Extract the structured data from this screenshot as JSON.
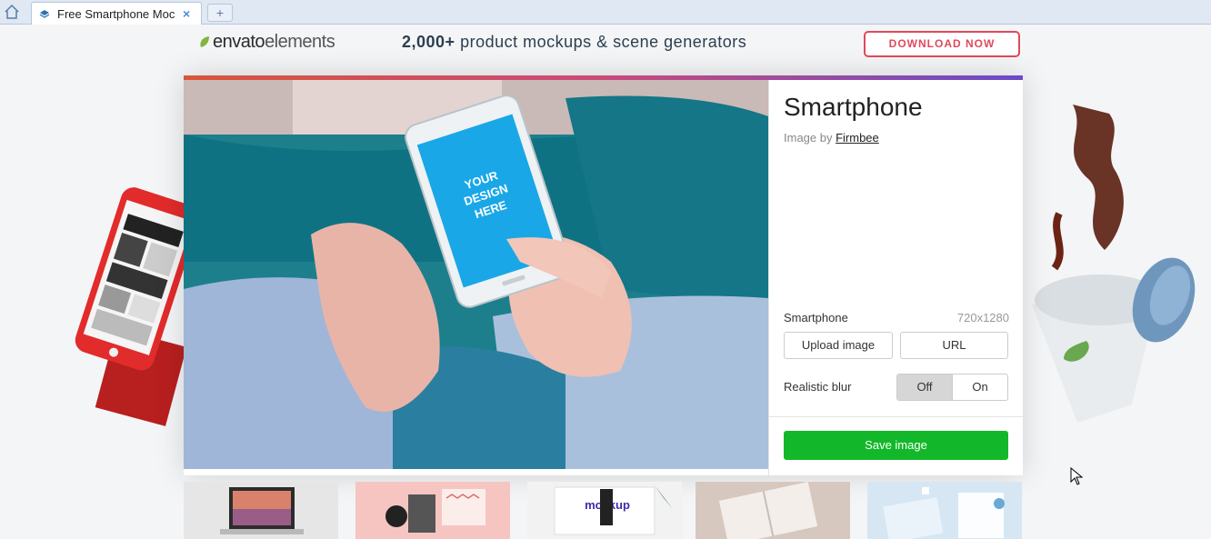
{
  "browser": {
    "tab_title": "Free Smartphone Moc",
    "tab_close": "×",
    "new_tab": "+"
  },
  "header": {
    "brand": "envato",
    "brand_sub": "elements",
    "promo_bold": "2,000+",
    "promo_rest": " product mockups & scene generators",
    "download_label": "DOWNLOAD NOW",
    "accent": "#e0495d"
  },
  "modal": {
    "title": "Smartphone",
    "credit_prefix": "Image by ",
    "credit_author": "Firmbee",
    "mockup_text": [
      "YOUR",
      "DESIGN",
      "HERE"
    ],
    "layer_name": "Smartphone",
    "layer_dimensions": "720x1280",
    "upload_label": "Upload image",
    "url_label": "URL",
    "blur_label": "Realistic blur",
    "blur_off": "Off",
    "blur_on": "On",
    "blur_selected": "Off",
    "save_label": "Save image",
    "save_color": "#12b829"
  },
  "thumbnails": {
    "items": [
      {
        "name": "laptop-mockup"
      },
      {
        "name": "envelope-mockup"
      },
      {
        "name": "mockup-frame",
        "label": "mockup"
      },
      {
        "name": "notebook-mockup"
      },
      {
        "name": "stationery-mockup"
      }
    ]
  }
}
